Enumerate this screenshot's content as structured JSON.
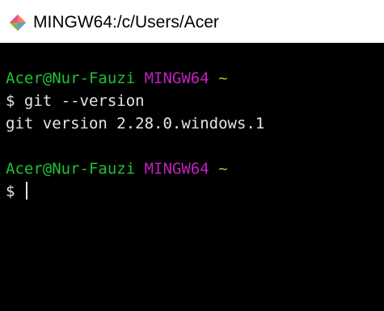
{
  "window": {
    "title": "MINGW64:/c/Users/Acer",
    "icon": "git-diamond-icon"
  },
  "terminal": {
    "prompt1": {
      "user_host": "Acer@Nur-Fauzi",
      "system": "MINGW64",
      "path": "~"
    },
    "command": "$ git --version",
    "output": "git version 2.28.0.windows.1",
    "prompt2": {
      "user_host": "Acer@Nur-Fauzi",
      "system": "MINGW64",
      "path": "~"
    },
    "input_prompt": "$ ",
    "colors": {
      "background": "#000000",
      "user_host": "#1ec234",
      "system": "#c01fc0",
      "path": "#c7b61c",
      "text": "#e6e6e6"
    }
  }
}
